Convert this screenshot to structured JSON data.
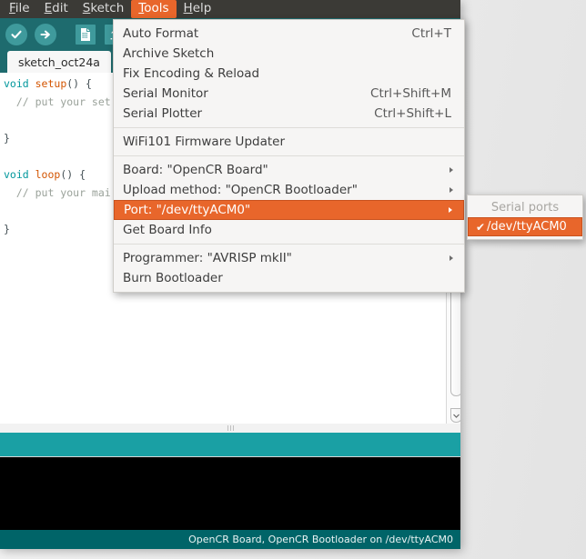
{
  "menubar": {
    "items": [
      {
        "mnemonic": "F",
        "rest": "ile",
        "name": "file"
      },
      {
        "mnemonic": "E",
        "rest": "dit",
        "name": "edit"
      },
      {
        "mnemonic": "S",
        "rest": "ketch",
        "name": "sketch"
      },
      {
        "mnemonic": "T",
        "rest": "ools",
        "name": "tools"
      },
      {
        "mnemonic": "H",
        "rest": "elp",
        "name": "help"
      }
    ]
  },
  "toolbar": {
    "verify_label": "Verify",
    "upload_label": "Upload",
    "new_label": "New",
    "open_label": "Open"
  },
  "tab": {
    "label": "sketch_oct24a"
  },
  "editor": {
    "lines": [
      {
        "segments": [
          {
            "t": "void ",
            "c": "kw"
          },
          {
            "t": "setup",
            "c": "fn"
          },
          {
            "t": "() {",
            "c": "pn"
          }
        ]
      },
      {
        "segments": [
          {
            "t": "  // put your set",
            "c": "cm"
          }
        ]
      },
      {
        "segments": []
      },
      {
        "segments": [
          {
            "t": "}",
            "c": "pn"
          }
        ]
      },
      {
        "segments": []
      },
      {
        "segments": [
          {
            "t": "void ",
            "c": "kw"
          },
          {
            "t": "loop",
            "c": "fn"
          },
          {
            "t": "() {",
            "c": "pn"
          }
        ]
      },
      {
        "segments": [
          {
            "t": "  // put your mai",
            "c": "cm"
          }
        ]
      },
      {
        "segments": []
      },
      {
        "segments": [
          {
            "t": "}",
            "c": "pn"
          }
        ]
      }
    ]
  },
  "tools_menu": {
    "items": [
      {
        "type": "item",
        "label": "Auto Format",
        "accel": "Ctrl+T",
        "name": "auto-format"
      },
      {
        "type": "item",
        "label": "Archive Sketch",
        "accel": "",
        "name": "archive-sketch"
      },
      {
        "type": "item",
        "label": "Fix Encoding & Reload",
        "accel": "",
        "name": "fix-encoding-reload"
      },
      {
        "type": "item",
        "label": "Serial Monitor",
        "accel": "Ctrl+Shift+M",
        "name": "serial-monitor"
      },
      {
        "type": "item",
        "label": "Serial Plotter",
        "accel": "Ctrl+Shift+L",
        "name": "serial-plotter"
      },
      {
        "type": "separator"
      },
      {
        "type": "item",
        "label": "WiFi101 Firmware Updater",
        "accel": "",
        "name": "wifi101-firmware-updater"
      },
      {
        "type": "separator"
      },
      {
        "type": "submenu",
        "label": "Board: \"OpenCR Board\"",
        "name": "board"
      },
      {
        "type": "submenu",
        "label": "Upload method: \"OpenCR Bootloader\"",
        "name": "upload-method"
      },
      {
        "type": "submenu",
        "label": "Port: \"/dev/ttyACM0\"",
        "name": "port",
        "selected": true
      },
      {
        "type": "item",
        "label": "Get Board Info",
        "accel": "",
        "name": "get-board-info"
      },
      {
        "type": "separator"
      },
      {
        "type": "submenu",
        "label": "Programmer: \"AVRISP mkII\"",
        "name": "programmer"
      },
      {
        "type": "item",
        "label": "Burn Bootloader",
        "accel": "",
        "name": "burn-bootloader"
      }
    ]
  },
  "port_submenu": {
    "header": "Serial ports",
    "items": [
      {
        "label": "/dev/ttyACM0",
        "checked": true,
        "check_glyph": "✔",
        "name": "port-dev-ttyacm0"
      }
    ]
  },
  "statusbar": {
    "text": "OpenCR Board, OpenCR Bootloader on /dev/ttyACM0"
  },
  "colors": {
    "menubar_bg": "#3b3a36",
    "toolbar_teal": "#1e6b6e",
    "band_teal": "#1aa0a4",
    "status_teal": "#006468",
    "highlight_orange": "#e8662b",
    "menu_bg": "#f6f5f4",
    "console_bg": "#000000"
  }
}
